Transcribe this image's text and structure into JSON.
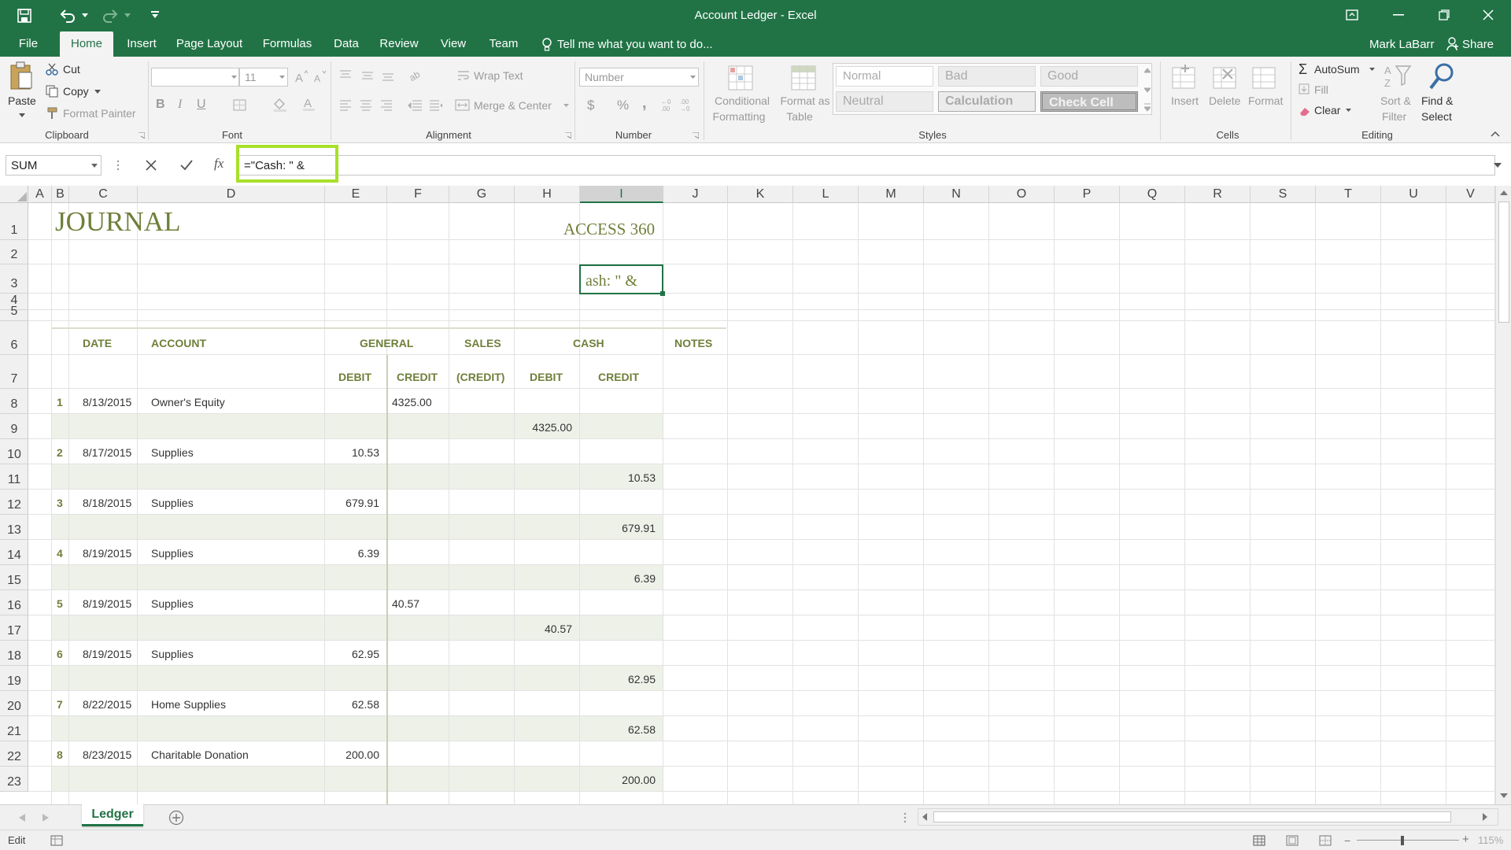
{
  "window": {
    "title": "Account Ledger - Excel"
  },
  "qat": {
    "save": "save-icon",
    "undo": "undo-icon",
    "redo": "redo-icon",
    "customize": "qat-customize-icon"
  },
  "tabs": [
    {
      "label": "File"
    },
    {
      "label": "Home"
    },
    {
      "label": "Insert"
    },
    {
      "label": "Page Layout"
    },
    {
      "label": "Formulas"
    },
    {
      "label": "Data"
    },
    {
      "label": "Review"
    },
    {
      "label": "View"
    },
    {
      "label": "Team"
    }
  ],
  "tell_me": "Tell me what you want to do...",
  "user": {
    "name": "Mark LaBarr",
    "share": "Share"
  },
  "ribbon": {
    "clipboard": {
      "paste": "Paste",
      "cut": "Cut",
      "copy": "Copy",
      "format_painter": "Format Painter",
      "label": "Clipboard"
    },
    "font": {
      "size": "11",
      "bold": "B",
      "italic": "I",
      "underline": "U",
      "label": "Font"
    },
    "alignment": {
      "wrap": "Wrap Text",
      "merge": "Merge & Center",
      "label": "Alignment"
    },
    "number": {
      "format": "Number",
      "label": "Number",
      "currency": "$",
      "percent": "%",
      "comma": ","
    },
    "styles": {
      "conditional": "Conditional",
      "conditional2": "Formatting",
      "format_table": "Format as",
      "format_table2": "Table",
      "normal": "Normal",
      "bad": "Bad",
      "good": "Good",
      "neutral": "Neutral",
      "calculation": "Calculation",
      "check": "Check Cell",
      "label": "Styles"
    },
    "cells": {
      "insert": "Insert",
      "delete": "Delete",
      "format": "Format",
      "label": "Cells"
    },
    "editing": {
      "autosum": "AutoSum",
      "fill": "Fill",
      "clear": "Clear",
      "sort": "Sort &",
      "sort2": "Filter",
      "find": "Find &",
      "find2": "Select",
      "label": "Editing"
    }
  },
  "formula_bar": {
    "name_box": "SUM",
    "formula": "=\"Cash: \" &",
    "fx": "fx"
  },
  "columns": [
    "A",
    "B",
    "C",
    "D",
    "E",
    "F",
    "G",
    "H",
    "I",
    "J",
    "K",
    "L",
    "M",
    "N",
    "O",
    "P",
    "Q",
    "R",
    "S",
    "T",
    "U",
    "V"
  ],
  "rows": [
    "1",
    "2",
    "3",
    "4",
    "5",
    "6",
    "7",
    "8",
    "9",
    "10",
    "11",
    "12",
    "13",
    "14",
    "15",
    "16",
    "17",
    "18",
    "19",
    "20",
    "21",
    "22",
    "23"
  ],
  "sheet": {
    "title": "JOURNAL",
    "subtitle": "ACCESS 360",
    "editing_cell": "ash: \" &",
    "headers": {
      "date": "DATE",
      "account": "ACCOUNT",
      "general": "GENERAL",
      "sales": "SALES",
      "cash": "CASH",
      "notes": "NOTES",
      "debit": "DEBIT",
      "credit": "CREDIT",
      "sales_credit": "(CREDIT)",
      "cash_debit": "DEBIT",
      "cash_credit": "CREDIT"
    },
    "entries": [
      {
        "num": "1",
        "date": "8/13/2015",
        "account": "Owner's Equity",
        "debit": "",
        "credit": "4325.00",
        "cash_debit": "4325.00",
        "cash_credit": ""
      },
      {
        "num": "2",
        "date": "8/17/2015",
        "account": "Supplies",
        "debit": "10.53",
        "credit": "",
        "cash_debit": "",
        "cash_credit": "10.53"
      },
      {
        "num": "3",
        "date": "8/18/2015",
        "account": "Supplies",
        "debit": "679.91",
        "credit": "",
        "cash_debit": "",
        "cash_credit": "679.91"
      },
      {
        "num": "4",
        "date": "8/19/2015",
        "account": "Supplies",
        "debit": "6.39",
        "credit": "",
        "cash_debit": "",
        "cash_credit": "6.39"
      },
      {
        "num": "5",
        "date": "8/19/2015",
        "account": "Supplies",
        "debit": "",
        "credit": "40.57",
        "cash_debit": "40.57",
        "cash_credit": ""
      },
      {
        "num": "6",
        "date": "8/19/2015",
        "account": "Supplies",
        "debit": "62.95",
        "credit": "",
        "cash_debit": "",
        "cash_credit": "62.95"
      },
      {
        "num": "7",
        "date": "8/22/2015",
        "account": "Home Supplies",
        "debit": "62.58",
        "credit": "",
        "cash_debit": "",
        "cash_credit": "62.58"
      },
      {
        "num": "8",
        "date": "8/23/2015",
        "account": "Charitable Donation",
        "debit": "200.00",
        "credit": "",
        "cash_debit": "",
        "cash_credit": "200.00"
      }
    ]
  },
  "sheet_tabs": [
    {
      "label": "Ledger"
    }
  ],
  "status": {
    "mode": "Edit",
    "zoom": "115%"
  },
  "colors": {
    "excel_green": "#217346",
    "journal_green": "#6f7f3a",
    "band": "#eef1e8",
    "highlight": "#a8e02a"
  }
}
